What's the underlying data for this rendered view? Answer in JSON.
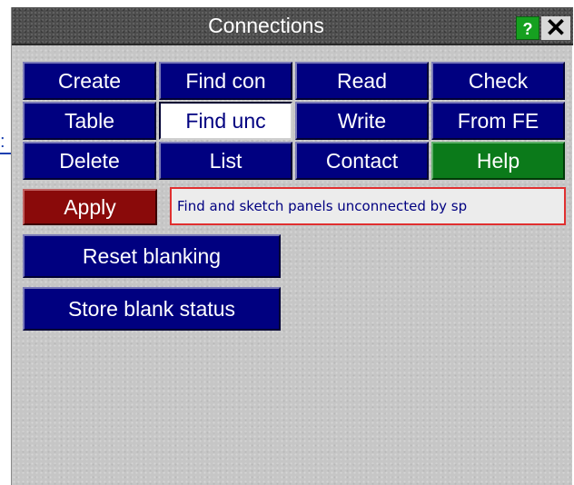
{
  "window": {
    "title": "Connections"
  },
  "titlebar": {
    "help_glyph": "?",
    "close_glyph": "✕"
  },
  "grid": [
    {
      "label": "Create",
      "state": "normal"
    },
    {
      "label": "Find con",
      "state": "normal"
    },
    {
      "label": "Read",
      "state": "normal"
    },
    {
      "label": "Check",
      "state": "normal"
    },
    {
      "label": "Table",
      "state": "normal"
    },
    {
      "label": "Find unc",
      "state": "selected"
    },
    {
      "label": "Write",
      "state": "normal"
    },
    {
      "label": "From FE",
      "state": "normal"
    },
    {
      "label": "Delete",
      "state": "normal"
    },
    {
      "label": "List",
      "state": "normal"
    },
    {
      "label": "Contact",
      "state": "normal"
    },
    {
      "label": "Help",
      "state": "normal"
    }
  ],
  "apply": {
    "label": "Apply"
  },
  "status": {
    "text": "Find and sketch panels unconnected by sp"
  },
  "actions": {
    "reset_blanking": "Reset blanking",
    "store_blank_status": "Store blank status"
  },
  "colors": {
    "button_blue": "#000080",
    "help_green": "#0b7a1a",
    "apply_red": "#8a0a0a",
    "status_border": "#e03030",
    "panel_grey": "#c6c6c6",
    "titlebar": "#4d4d4d"
  }
}
